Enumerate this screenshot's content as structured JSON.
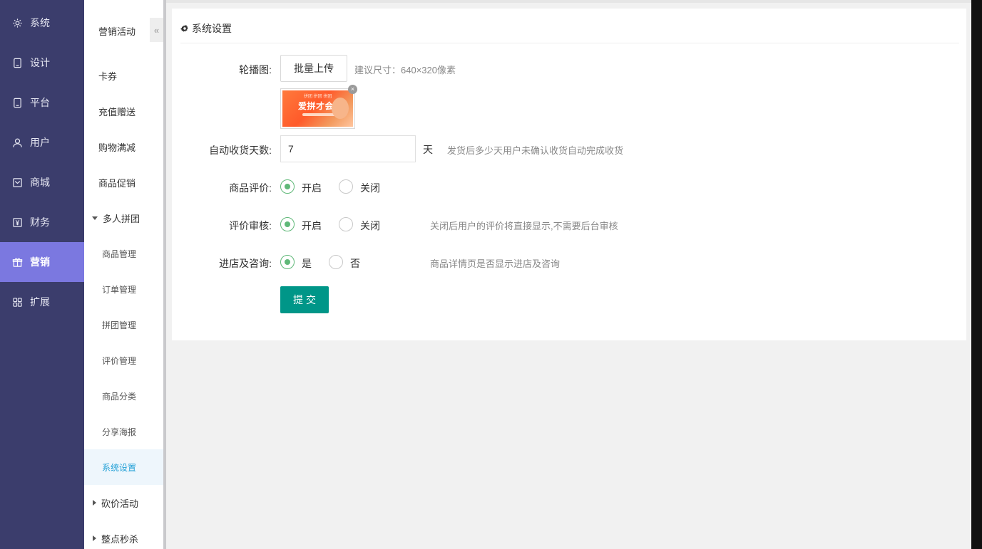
{
  "nav": {
    "items": [
      {
        "label": "系统",
        "icon": "gear-icon"
      },
      {
        "label": "设计",
        "icon": "tablet-icon"
      },
      {
        "label": "平台",
        "icon": "tablet-icon"
      },
      {
        "label": "用户",
        "icon": "user-icon"
      },
      {
        "label": "商城",
        "icon": "mail-icon"
      },
      {
        "label": "财务",
        "icon": "yen-icon"
      },
      {
        "label": "营销",
        "icon": "gift-icon"
      },
      {
        "label": "扩展",
        "icon": "grid-icon"
      }
    ],
    "active": "营销"
  },
  "sub": {
    "title": "营销活动",
    "collapse_icon": "«",
    "items": [
      "卡券",
      "充值赠送",
      "购物满减",
      "商品促销"
    ],
    "group_open": "多人拼团",
    "children": [
      "商品管理",
      "订单管理",
      "拼团管理",
      "评价管理",
      "商品分类",
      "分享海报",
      "系统设置"
    ],
    "active_child": "系统设置",
    "group_collapsed": [
      "砍价活动",
      "整点秒杀"
    ]
  },
  "card": {
    "title": "系统设置",
    "carousel": {
      "label": "轮播图:",
      "upload_button": "批量上传",
      "hint": "建议尺寸：640×320像素",
      "thumb_text": "爱拼才会IN",
      "thumb_tag": "拼团 拼团 拼团",
      "delete_icon": "×"
    },
    "auto_receive": {
      "label": "自动收货天数:",
      "value": "7",
      "unit": "天",
      "hint": "发货后多少天用户未确认收货自动完成收货"
    },
    "review": {
      "label": "商品评价:",
      "on": "开启",
      "off": "关闭",
      "selected": "开启"
    },
    "review_audit": {
      "label": "评价审核:",
      "on": "开启",
      "off": "关闭",
      "selected": "开启",
      "hint": "关闭后用户的评价将直接显示,不需要后台审核"
    },
    "store_consult": {
      "label": "进店及咨询:",
      "yes": "是",
      "no": "否",
      "selected": "是",
      "hint": "商品详情页是否显示进店及咨询"
    },
    "submit": "提交"
  },
  "colors": {
    "nav_bg": "#3b3d6c",
    "nav_active": "#7b78e0",
    "submit": "#009688",
    "radio_on": "#5fb878",
    "sub_active_text": "#1f9fd6"
  }
}
